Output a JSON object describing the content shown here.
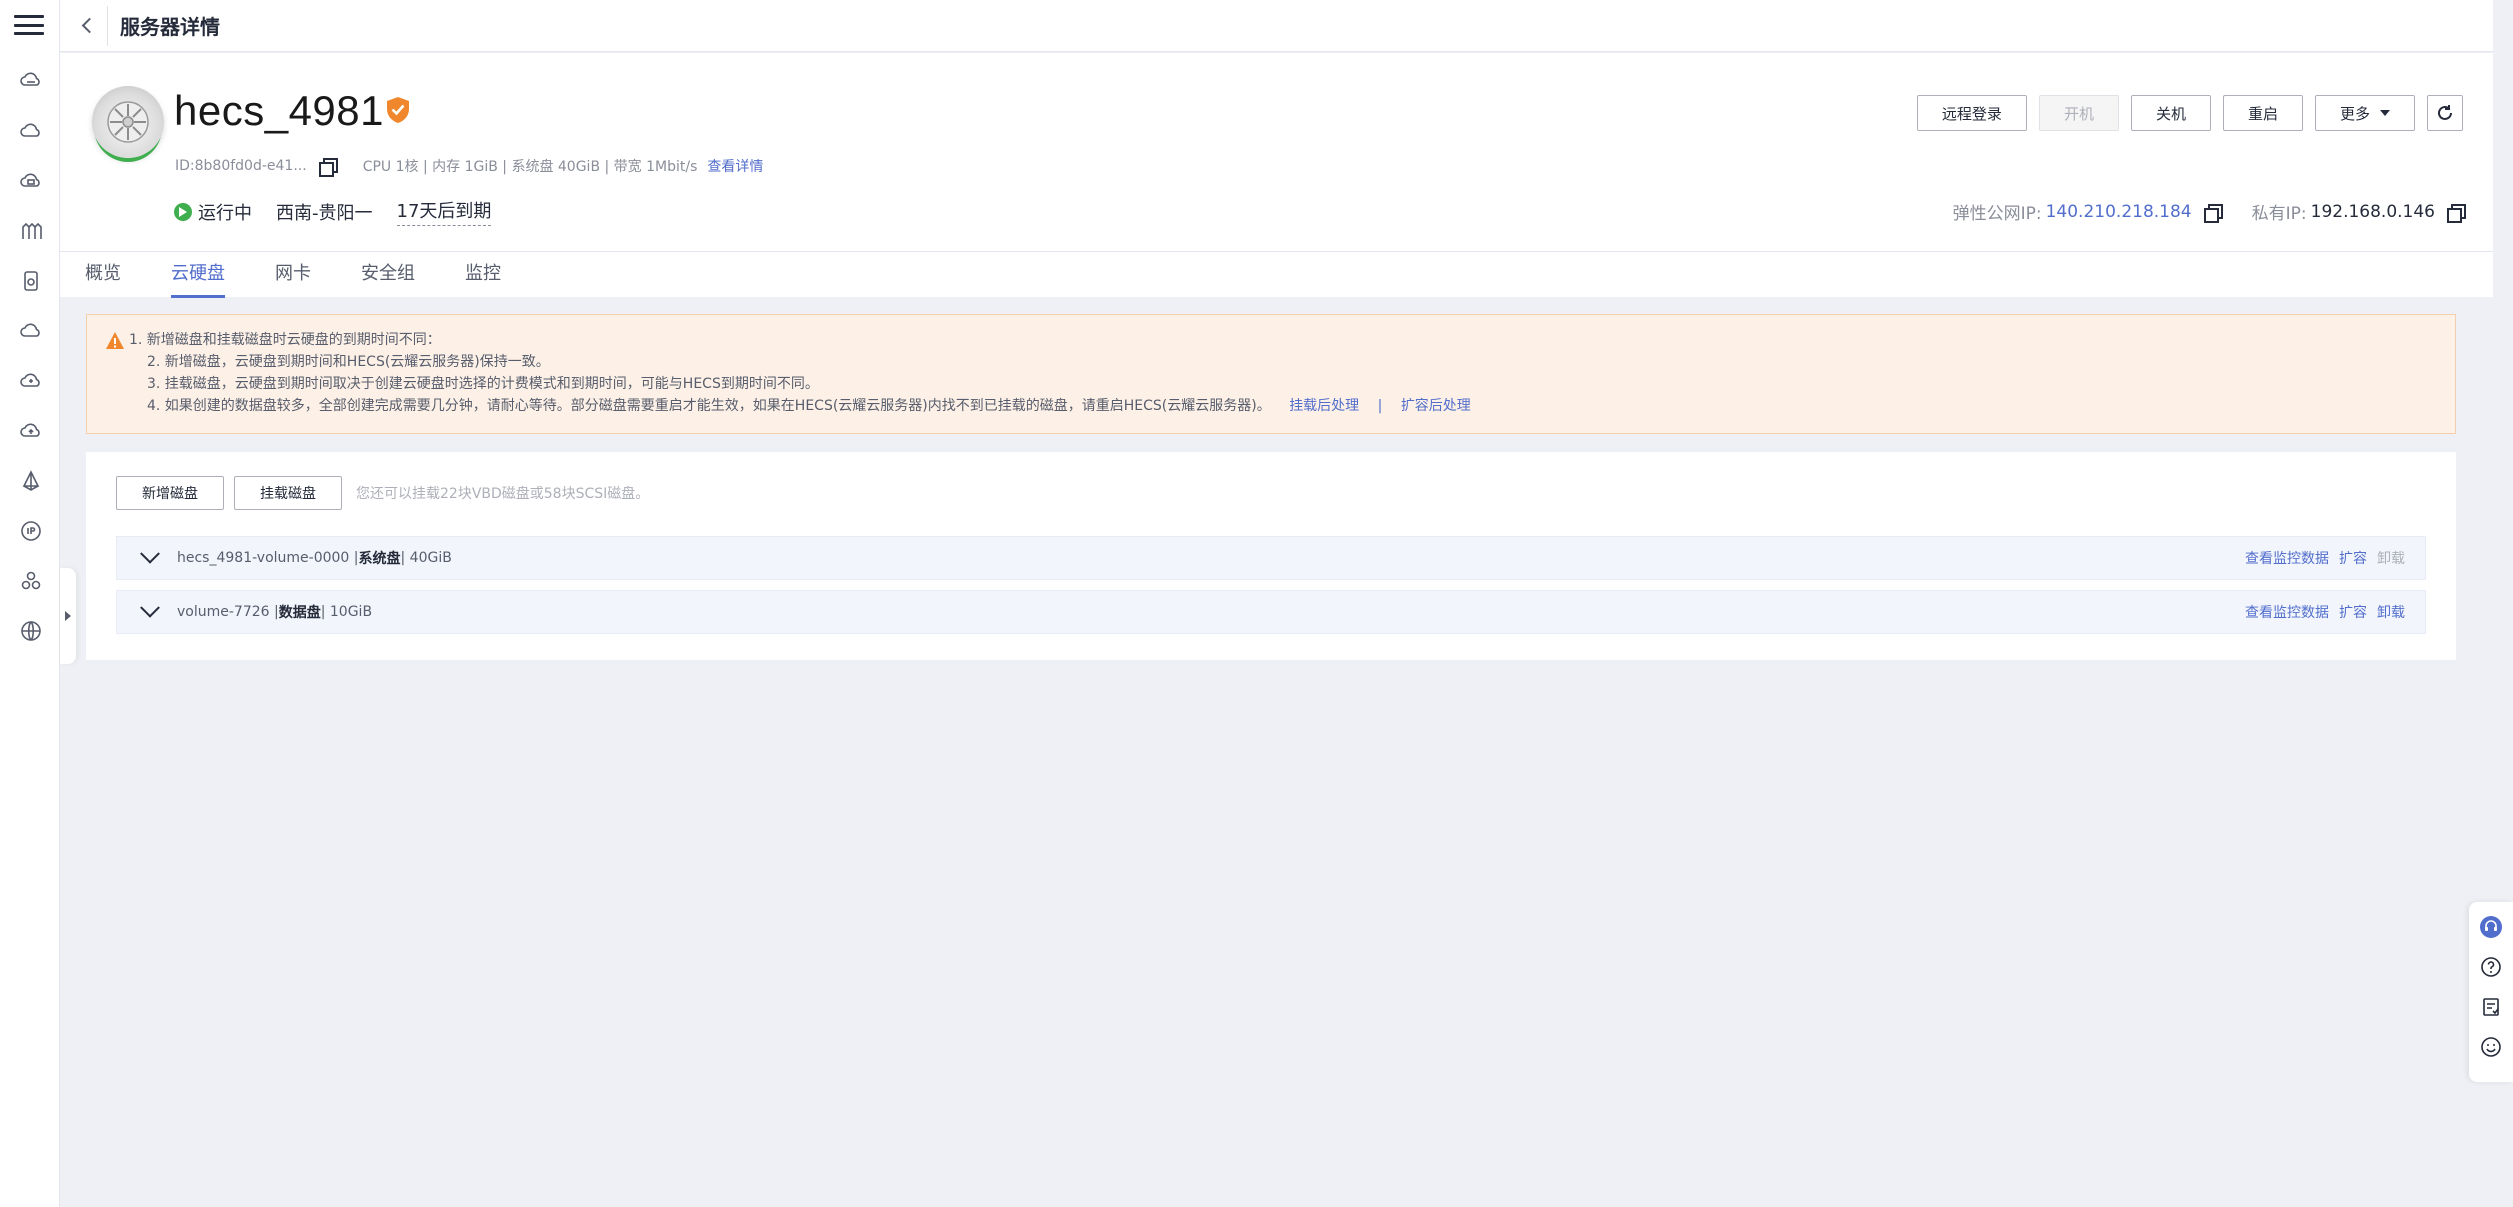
{
  "page": {
    "title": "服务器详情"
  },
  "server": {
    "name": "hecs_4981",
    "id": "ID:8b80fd0d-e41...",
    "specs": "CPU 1核 | 内存 1GiB | 系统盘 40GiB | 带宽 1Mbit/s",
    "details_link": "查看详情",
    "status": "运行中",
    "region": "西南-贵阳一",
    "expiry": "17天后到期",
    "public_ip_label": "弹性公网IP:",
    "public_ip": "140.210.218.184",
    "private_ip_label": "私有IP:",
    "private_ip": "192.168.0.146"
  },
  "actions": {
    "remote_login": "远程登录",
    "power_on": "开机",
    "power_off": "关机",
    "restart": "重启",
    "more": "更多"
  },
  "tabs": [
    {
      "label": "概览"
    },
    {
      "label": "云硬盘",
      "active": true
    },
    {
      "label": "网卡"
    },
    {
      "label": "安全组"
    },
    {
      "label": "监控"
    }
  ],
  "notice": {
    "items": [
      "1. 新增磁盘和挂载磁盘时云硬盘的到期时间不同：",
      "2. 新增磁盘，云硬盘到期时间和HECS(云耀云服务器)保持一致。",
      "3. 挂载磁盘，云硬盘到期时间取决于创建云硬盘时选择的计费模式和到期时间，可能与HECS到期时间不同。",
      "4. 如果创建的数据盘较多，全部创建完成需要几分钟，请耐心等待。部分磁盘需要重启才能生效，如果在HECS(云耀云服务器)内找不到已挂载的磁盘，请重启HECS(云耀云服务器)。"
    ],
    "link_attach": "挂载后处理",
    "link_expand": "扩容后处理",
    "pipe": "|"
  },
  "disks": {
    "add_button": "新增磁盘",
    "attach_button": "挂载磁盘",
    "hint": "您还可以挂载22块VBD磁盘或58块SCSI磁盘。",
    "rows": [
      {
        "name": "hecs_4981-volume-0000 | ",
        "type": "系统盘",
        "size": " | 40GiB",
        "monitor": "查看监控数据",
        "expand": "扩容",
        "detach": "卸载",
        "detach_disabled": true
      },
      {
        "name": "volume-7726 | ",
        "type": "数据盘",
        "size": " | 10GiB",
        "monitor": "查看监控数据",
        "expand": "扩容",
        "detach": "卸载",
        "detach_disabled": false
      }
    ]
  },
  "colors": {
    "accent": "#526ecc",
    "running": "#3fae4f",
    "warning_bg": "#fdf1e7",
    "warning_icon": "#f0872c"
  }
}
